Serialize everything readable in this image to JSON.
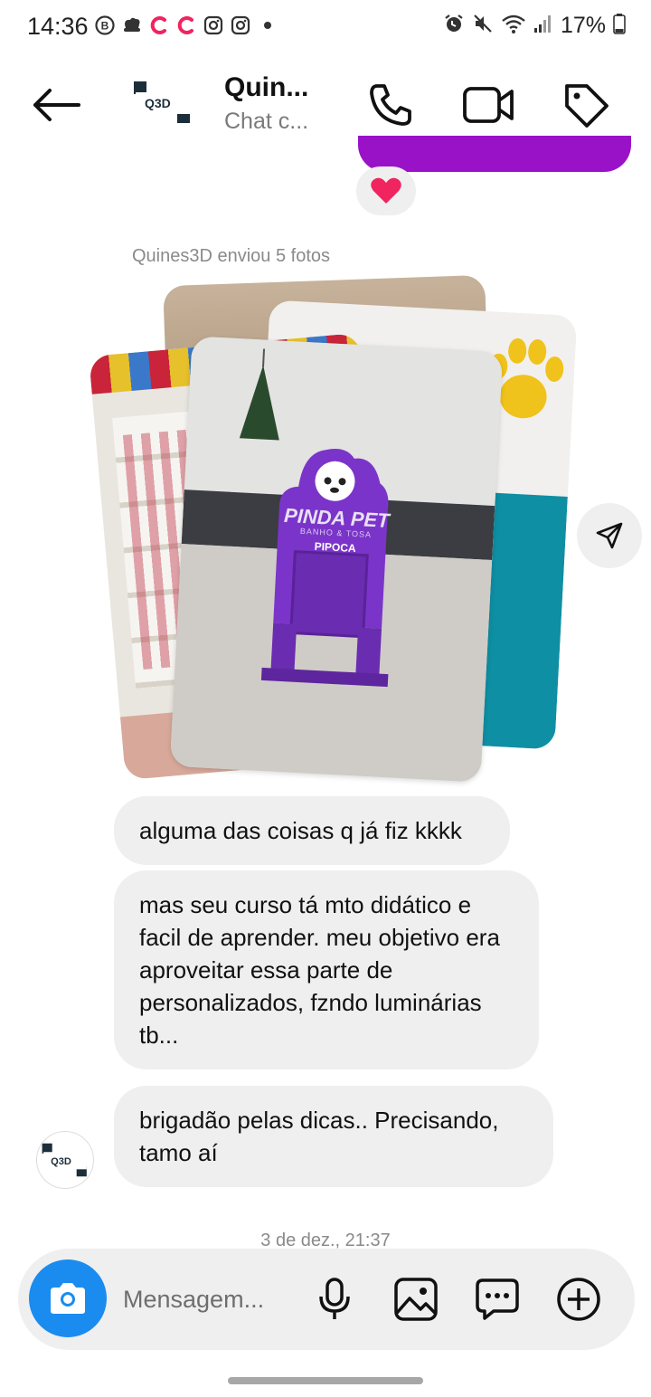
{
  "status_bar": {
    "time": "14:36",
    "battery": "17%",
    "left_icons": [
      "b-icon",
      "chef-hat-icon",
      "c-icon",
      "c-icon",
      "instagram-icon",
      "instagram-icon",
      "dot-icon"
    ],
    "right_icons": [
      "alarm-icon",
      "mute-icon",
      "wifi-icon",
      "signal-icon",
      "battery-icon"
    ]
  },
  "header": {
    "title": "Quin...",
    "subtitle": "Chat c...",
    "avatar_text": "Q3D",
    "icons": [
      "back-arrow-icon",
      "phone-icon",
      "video-camera-icon",
      "tag-icon"
    ]
  },
  "conversation": {
    "reaction": "heart",
    "sent_label": "Quines3D enviou 5 fotos",
    "photo_sign": {
      "brand": "PINDA PET",
      "tagline": "BANHO & TOSA",
      "name": "PIPOCA"
    },
    "messages": [
      {
        "text": "alguma das coisas q já fiz kkkk"
      },
      {
        "text": "mas seu curso tá mto didático e facil de aprender. meu objetivo era aproveitar essa parte de personalizados, fzndo luminárias tb..."
      },
      {
        "text": "brigadão pelas dicas.. Precisando, tamo aí"
      }
    ],
    "avatar_text": "Q3D",
    "timestamp": "3 de dez., 21:37"
  },
  "composer": {
    "placeholder": "Mensagem...",
    "icons": [
      "camera-icon",
      "microphone-icon",
      "image-icon",
      "sticker-chat-icon",
      "add-icon"
    ]
  },
  "colors": {
    "accent_blue": "#1a8cf0",
    "sent_bubble": "#9a12c8",
    "received_bubble": "#efefef",
    "sign_purple": "#7b34c9",
    "teal_wall": "#0e8fa3",
    "paw_yellow": "#f0c21c"
  }
}
